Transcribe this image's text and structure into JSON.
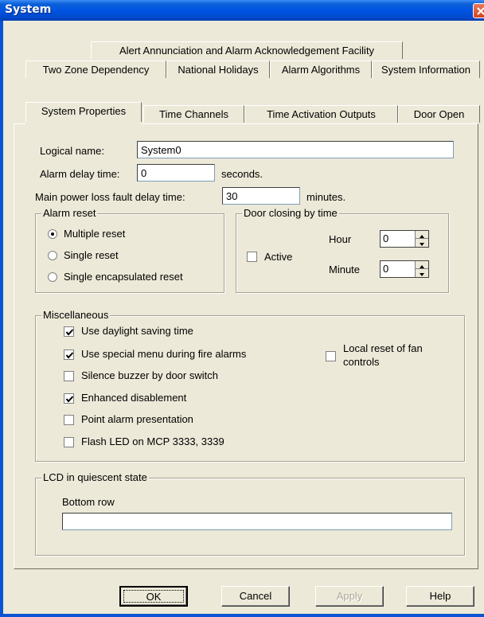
{
  "window": {
    "title": "System"
  },
  "tabs": {
    "row1": [
      "Alert Annunciation and Alarm Acknowledgement Facility"
    ],
    "row2": [
      "Two Zone Dependency",
      "National Holidays",
      "Alarm Algorithms",
      "System Information"
    ],
    "row3": [
      "System Properties",
      "Time Channels",
      "Time Activation Outputs",
      "Door Open"
    ],
    "active": "System Properties"
  },
  "form": {
    "logical_name_label": "Logical name:",
    "logical_name_value": "System0",
    "alarm_delay_label": "Alarm delay time:",
    "alarm_delay_value": "0",
    "alarm_delay_unit": "seconds.",
    "power_loss_label": "Main power loss fault delay time:",
    "power_loss_value": "30",
    "power_loss_unit": "minutes."
  },
  "alarm_reset": {
    "title": "Alarm reset",
    "options": [
      "Multiple reset",
      "Single reset",
      "Single encapsulated reset"
    ],
    "selected": "Multiple reset"
  },
  "door_closing": {
    "title": "Door closing by time",
    "active_label": "Active",
    "active_checked": false,
    "hour_label": "Hour",
    "hour_value": "0",
    "minute_label": "Minute",
    "minute_value": "0"
  },
  "misc": {
    "title": "Miscellaneous",
    "items": [
      {
        "label": "Use daylight saving time",
        "checked": true
      },
      {
        "label": "Use special menu during fire alarms",
        "checked": true
      },
      {
        "label": "Silence buzzer by door switch",
        "checked": false
      },
      {
        "label": "Enhanced disablement",
        "checked": true
      },
      {
        "label": "Point alarm presentation",
        "checked": false
      },
      {
        "label": "Flash LED on MCP 3333, 3339",
        "checked": false
      }
    ],
    "fan_label_line1": "Local reset of fan",
    "fan_label_line2": "controls",
    "fan_checked": false
  },
  "lcd": {
    "title": "LCD in quiescent state",
    "bottom_row_label": "Bottom row",
    "bottom_row_value": ""
  },
  "buttons": {
    "ok": "OK",
    "cancel": "Cancel",
    "apply": "Apply",
    "help": "Help"
  }
}
